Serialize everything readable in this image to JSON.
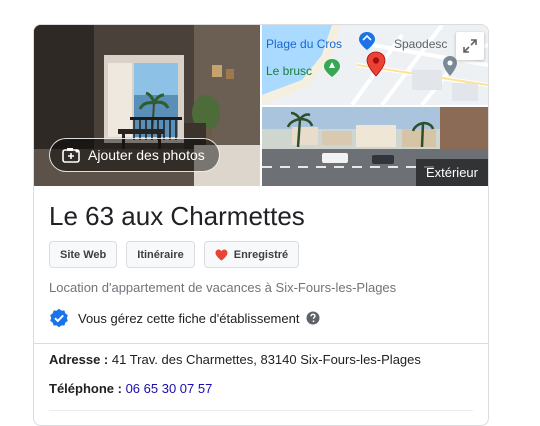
{
  "gallery": {
    "add_photos_label": "Ajouter des photos",
    "exterior_label": "Extérieur",
    "map_labels": {
      "beach": "Plage du Cros",
      "area": "Le brusc",
      "place": "Spaodesc"
    }
  },
  "business": {
    "name": "Le 63 aux Charmettes",
    "category": "Location d'appartement de vacances à Six-Fours-les-Plages",
    "verified_text": "Vous gérez cette fiche d'établissement"
  },
  "actions": {
    "website": "Site Web",
    "directions": "Itinéraire",
    "saved": "Enregistré"
  },
  "details": {
    "address_label": "Adresse :",
    "address": "41 Trav. des Charmettes, 83140 Six-Fours-les-Plages",
    "phone_label": "Téléphone :",
    "phone": "06 65 30 07 57"
  },
  "colors": {
    "accent_blue": "#1a73e8",
    "saved_heart": "#ea4335",
    "map_pin_red": "#ea4335",
    "map_pin_green": "#34a853",
    "map_label_blue": "#1967d2",
    "map_label_green": "#188038",
    "link_blue": "#1a0dab"
  },
  "icons": [
    "camera-plus-icon",
    "expand-icon",
    "heart-icon",
    "verified-check-icon",
    "help-icon",
    "map-pin-icon",
    "beach-pin-icon"
  ]
}
